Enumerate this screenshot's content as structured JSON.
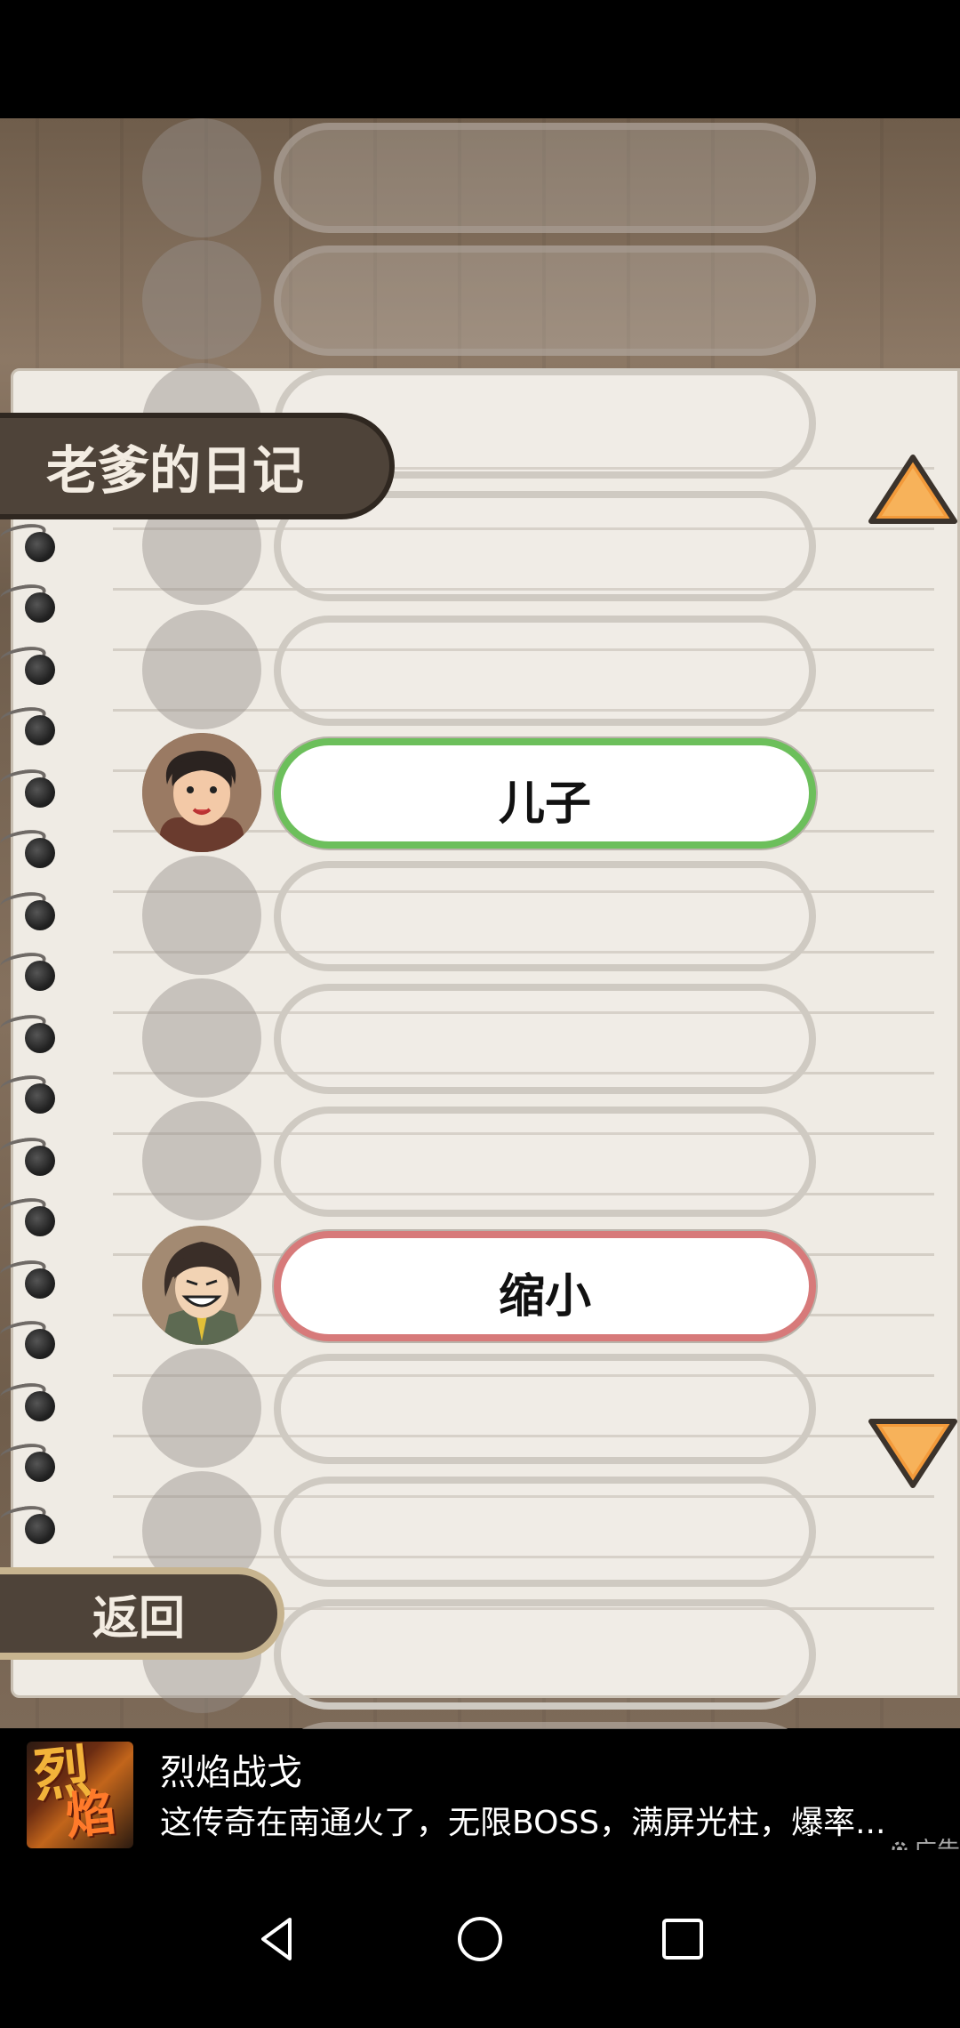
{
  "diary": {
    "title": "老爹的日记",
    "back_label": "返回"
  },
  "entries": [
    {
      "label": "",
      "state": "empty-faded"
    },
    {
      "label": "",
      "state": "empty-faded"
    },
    {
      "label": "",
      "state": "empty"
    },
    {
      "label": "",
      "state": "empty"
    },
    {
      "label": "",
      "state": "empty"
    },
    {
      "label": "儿子",
      "state": "unlocked-green"
    },
    {
      "label": "",
      "state": "empty"
    },
    {
      "label": "",
      "state": "empty"
    },
    {
      "label": "",
      "state": "empty"
    },
    {
      "label": "缩小",
      "state": "unlocked-red"
    },
    {
      "label": "",
      "state": "empty"
    },
    {
      "label": "",
      "state": "empty"
    },
    {
      "label": "",
      "state": "empty"
    },
    {
      "label": "",
      "state": "empty-faded"
    }
  ],
  "colors": {
    "accent_arrow": "#f39a3a",
    "green_border": "#6cbf5b",
    "red_border": "#d77a7a",
    "tab_background": "#4e4339"
  },
  "ad": {
    "title": "烈焰战戈",
    "description": "这传奇在南通火了，无限BOSS，满屏光柱，爆率...",
    "tag": "广告",
    "icon_text_1": "烈",
    "icon_text_2": "焰"
  },
  "navbar": {
    "icons": [
      "back-triangle-icon",
      "home-circle-icon",
      "recents-square-icon"
    ]
  }
}
